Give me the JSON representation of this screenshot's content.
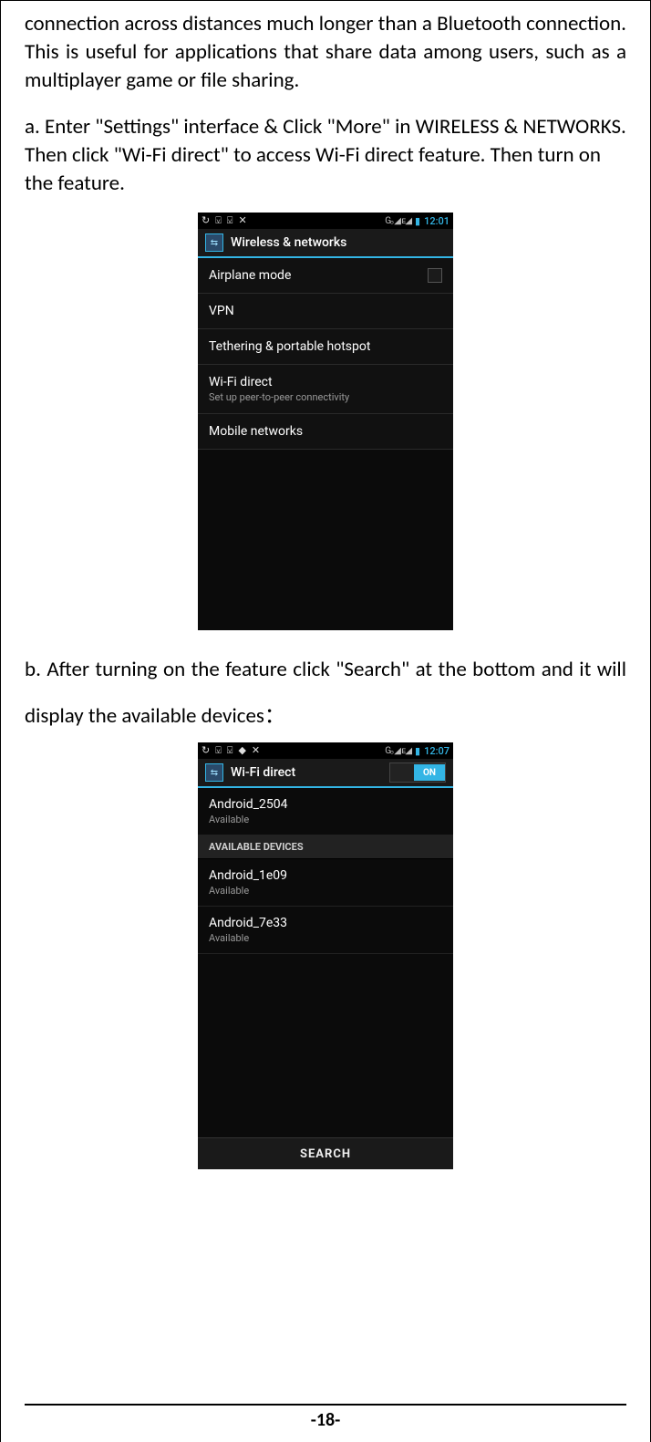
{
  "para_intro": "connection across distances much longer than a Bluetooth connection. This is useful for applications that share data among users, such as a multiplayer game or file sharing.",
  "step_a": "a. Enter \"Settings\" interface & Click \"More\" in WIRELESS & NETWORKS. Then click \"Wi-Fi direct\" to access Wi-Fi direct feature. Then turn on the feature.",
  "step_b": "b. After turning on the feature click \"Search\" at the bottom and it will display the available devices：",
  "page_number": "-18-",
  "shot_a": {
    "status": {
      "net_text": "Gₒ ◢  ᴇ◢",
      "clock": "12:01"
    },
    "title": "Wireless & networks",
    "rows": {
      "airplane": "Airplane mode",
      "vpn": "VPN",
      "tether": "Tethering & portable hotspot",
      "wifidirect": {
        "title": "Wi-Fi direct",
        "sub": "Set up peer-to-peer connectivity"
      },
      "mobile": "Mobile networks"
    }
  },
  "shot_b": {
    "status": {
      "net_text": "Gₒ ◢  ᴇ◢",
      "clock": "12:07"
    },
    "title": "Wi-Fi direct",
    "toggle_label": "ON",
    "self": {
      "name": "Android_2504",
      "status": "Available"
    },
    "section": "AVAILABLE DEVICES",
    "devices": [
      {
        "name": "Android_1e09",
        "status": "Available"
      },
      {
        "name": "Android_7e33",
        "status": "Available"
      }
    ],
    "search": "SEARCH"
  }
}
